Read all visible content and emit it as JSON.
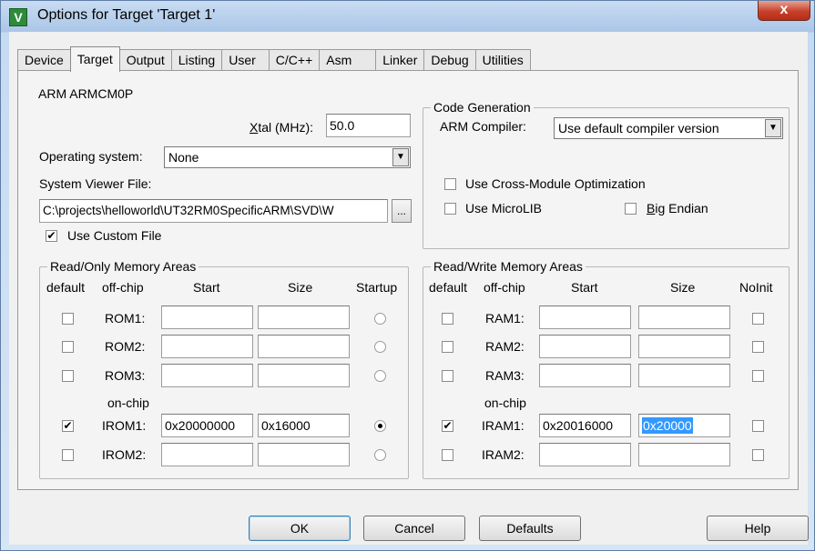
{
  "window": {
    "title": "Options for Target 'Target 1'",
    "app_icon_glyph": "V",
    "close_glyph": "x"
  },
  "tabs": [
    "Device",
    "Target",
    "Output",
    "Listing",
    "User",
    "C/C++",
    "Asm",
    "Linker",
    "Debug",
    "Utilities"
  ],
  "active_tab": "Target",
  "target": {
    "device_name": "ARM ARMCM0P",
    "xtal_label_underlined": "X",
    "xtal_label_rest": "tal (MHz):",
    "xtal_value": "50.0",
    "os_label": "Operating system:",
    "os_value": "None",
    "svd_label": "System Viewer File:",
    "svd_value": "C:\\projects\\helloworld\\UT32RM0SpecificARM\\SVD\\W",
    "browse_label": "...",
    "use_custom_file_label": "Use Custom File",
    "use_custom_file_checked": true
  },
  "code_generation": {
    "title": "Code Generation",
    "compiler_label": "ARM Compiler:",
    "compiler_value": "Use default compiler version",
    "cross_module_label": "Use Cross-Module Optimization",
    "microlib_label": "Use MicroLIB",
    "big_endian_underlined": "B",
    "big_endian_rest": "ig Endian"
  },
  "rom": {
    "title": "Read/Only Memory Areas",
    "headers": {
      "default": "default",
      "offchip": "off-chip",
      "start": "Start",
      "size": "Size",
      "startup": "Startup"
    },
    "onchip_label": "on-chip",
    "rows": [
      {
        "label": "ROM1:",
        "start": "",
        "size": "",
        "default": false,
        "startup": false
      },
      {
        "label": "ROM2:",
        "start": "",
        "size": "",
        "default": false,
        "startup": false
      },
      {
        "label": "ROM3:",
        "start": "",
        "size": "",
        "default": false,
        "startup": false
      },
      {
        "label": "IROM1:",
        "start": "0x20000000",
        "size": "0x16000",
        "default": true,
        "startup": true
      },
      {
        "label": "IROM2:",
        "start": "",
        "size": "",
        "default": false,
        "startup": false
      }
    ]
  },
  "ram": {
    "title": "Read/Write Memory Areas",
    "headers": {
      "default": "default",
      "offchip": "off-chip",
      "start": "Start",
      "size": "Size",
      "noinit": "NoInit"
    },
    "onchip_label": "on-chip",
    "rows": [
      {
        "label": "RAM1:",
        "start": "",
        "size": "",
        "default": false
      },
      {
        "label": "RAM2:",
        "start": "",
        "size": "",
        "default": false
      },
      {
        "label": "RAM3:",
        "start": "",
        "size": "",
        "default": false
      },
      {
        "label": "IRAM1:",
        "start": "0x20016000",
        "size": "0x20000",
        "default": true
      },
      {
        "label": "IRAM2:",
        "start": "",
        "size": "",
        "default": false
      }
    ]
  },
  "buttons": {
    "ok": "OK",
    "cancel": "Cancel",
    "defaults": "Defaults",
    "help": "Help"
  },
  "check_glyph": "✔"
}
